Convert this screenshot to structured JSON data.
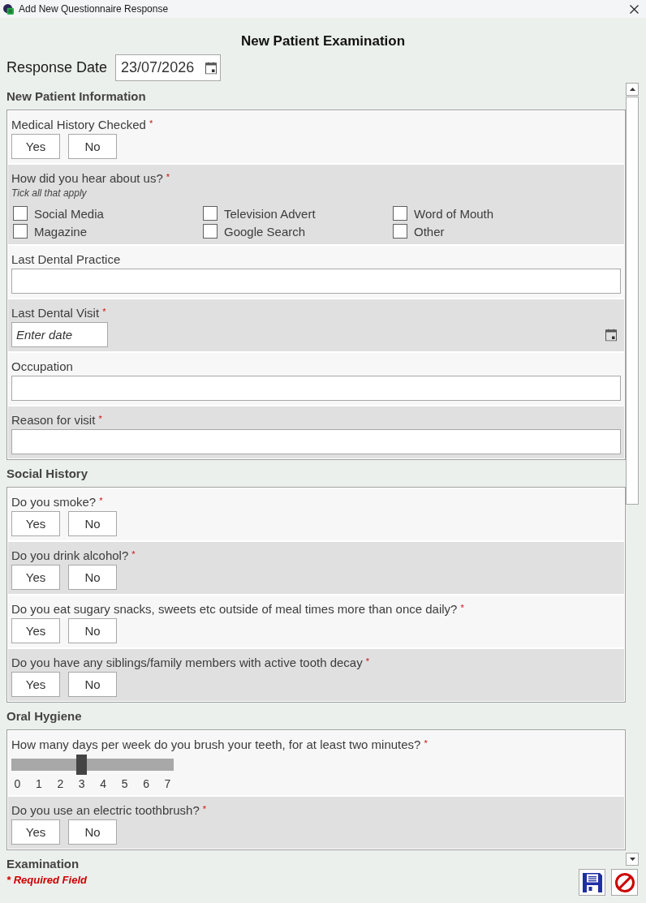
{
  "window": {
    "title": "Add New Questionnaire Response"
  },
  "form": {
    "title": "New Patient Examination",
    "response_date": {
      "label": "Response Date",
      "value": "23/07/2026"
    }
  },
  "sections": [
    {
      "title": "New Patient Information",
      "questions": [
        {
          "kind": "yes_no",
          "label": "Medical History Checked",
          "required_mark": "*",
          "options": [
            {
              "label": "Yes",
              "selected": false
            },
            {
              "label": "No",
              "selected": false
            }
          ]
        },
        {
          "kind": "checkboxes",
          "label": "How did you hear about us?",
          "required_mark": "*",
          "hint": "Tick all that apply",
          "options": [
            {
              "label": "Social Media",
              "checked": false
            },
            {
              "label": "Television Advert",
              "checked": false
            },
            {
              "label": "Word of Mouth",
              "checked": false
            },
            {
              "label": "Magazine",
              "checked": false
            },
            {
              "label": "Google Search",
              "checked": false
            },
            {
              "label": "Other",
              "checked": false
            }
          ]
        },
        {
          "kind": "text",
          "label": "Last Dental Practice"
        },
        {
          "kind": "date",
          "label": "Last Dental Visit",
          "required_mark": "*",
          "placeholder": "Enter date"
        },
        {
          "kind": "text",
          "label": "Occupation"
        },
        {
          "kind": "text",
          "label": "Reason for visit",
          "required_mark": "*"
        }
      ]
    },
    {
      "title": "Social History",
      "questions": [
        {
          "kind": "yes_no",
          "label": "Do you smoke?",
          "required_mark": "*",
          "options": [
            {
              "label": "Yes",
              "selected": false
            },
            {
              "label": "No",
              "selected": false
            }
          ]
        },
        {
          "kind": "yes_no",
          "label": "Do you drink alcohol?",
          "required_mark": "*",
          "options": [
            {
              "label": "Yes",
              "selected": false
            },
            {
              "label": "No",
              "selected": false
            }
          ]
        },
        {
          "kind": "yes_no",
          "label": "Do you eat sugary snacks, sweets etc outside of meal times more than once daily?",
          "required_mark": "*",
          "options": [
            {
              "label": "Yes",
              "selected": false
            },
            {
              "label": "No",
              "selected": false
            }
          ]
        },
        {
          "kind": "yes_no",
          "label": "Do you have any siblings/family members with active tooth decay",
          "required_mark": "*",
          "options": [
            {
              "label": "Yes",
              "selected": false
            },
            {
              "label": "No",
              "selected": false
            }
          ]
        }
      ]
    },
    {
      "title": "Oral Hygiene",
      "questions": [
        {
          "kind": "slider",
          "label": "How many days per week do you brush your teeth, for at least two minutes?",
          "required_mark": "*",
          "level": 0.4286,
          "ticks": [
            "0",
            "1",
            "2",
            "3",
            "4",
            "5",
            "6",
            "7"
          ]
        },
        {
          "kind": "yes_no",
          "label": "Do you use an electric toothbrush?",
          "required_mark": "*",
          "options": [
            {
              "label": "Yes",
              "selected": false
            },
            {
              "label": "No",
              "selected": false
            }
          ]
        }
      ]
    },
    {
      "title": "Examination"
    }
  ],
  "footer": {
    "required_note": "* Required Field"
  }
}
